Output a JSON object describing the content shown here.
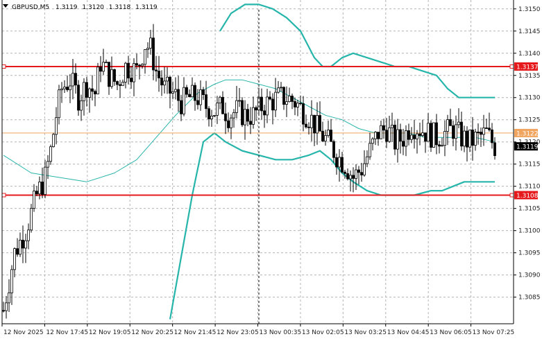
{
  "chart_data": {
    "type": "candlestick",
    "header": {
      "symbol": "GBPUSD,M5",
      "ohlc": [
        "1.3119",
        "1.3120",
        "1.3118",
        "1.3119"
      ]
    },
    "colors": {
      "background": "#ffffff",
      "grid": "#b4b4b4",
      "candle": "#000000",
      "bollinger_outer": "#26b5aa",
      "bollinger_middle": "#26b5aa",
      "hline": "#e5191c",
      "current_price_line": "#f0a45e",
      "axis": "#000000"
    },
    "y_axis": {
      "ylim": [
        1.3079,
        1.3152
      ],
      "ticks": [
        "1.3150",
        "1.3145",
        "1.3140",
        "1.3135",
        "1.3130",
        "1.3125",
        "1.3120",
        "1.3115",
        "1.3110",
        "1.3105",
        "1.3100",
        "1.3095",
        "1.3090",
        "1.3085"
      ]
    },
    "x_axis": {
      "ticks": [
        "12 Nov 2025",
        "12 Nov 17:45",
        "12 Nov 19:05",
        "12 Nov 20:25",
        "12 Nov 21:45",
        "12 Nov 23:05",
        "13 Nov 00:35",
        "13 Nov 02:05",
        "13 Nov 03:25",
        "13 Nov 04:45",
        "13 Nov 06:05",
        "13 Nov 07:25"
      ]
    },
    "horizontal_lines": [
      {
        "price": 1.3137,
        "label": "1.3137",
        "kind": "level"
      },
      {
        "price": 1.3108,
        "label": "1.3108",
        "kind": "level"
      },
      {
        "price": 1.3122,
        "label": "1.3122",
        "kind": "orange"
      }
    ],
    "current_price_label": "1.3119",
    "crosshair_bar": 92,
    "candles_close_path": [
      [
        0,
        1.3082
      ],
      [
        4,
        1.3095
      ],
      [
        8,
        1.31
      ],
      [
        12,
        1.3108
      ],
      [
        15,
        1.3112
      ],
      [
        17,
        1.3118
      ],
      [
        19,
        1.3126
      ],
      [
        21,
        1.3132
      ],
      [
        24,
        1.3134
      ],
      [
        27,
        1.313
      ],
      [
        30,
        1.3133
      ],
      [
        33,
        1.3131
      ],
      [
        35,
        1.3138
      ],
      [
        38,
        1.3135
      ],
      [
        41,
        1.3133
      ],
      [
        44,
        1.3137
      ],
      [
        48,
        1.3136
      ],
      [
        51,
        1.3142
      ],
      [
        53,
        1.3141
      ],
      [
        55,
        1.3136
      ],
      [
        58,
        1.3132
      ],
      [
        61,
        1.3131
      ],
      [
        64,
        1.3129
      ],
      [
        67,
        1.313
      ],
      [
        70,
        1.313
      ],
      [
        73,
        1.3128
      ],
      [
        76,
        1.3127
      ],
      [
        79,
        1.3128
      ],
      [
        81,
        1.3126
      ],
      [
        84,
        1.3127
      ],
      [
        87,
        1.3126
      ],
      [
        90,
        1.3126
      ],
      [
        93,
        1.3128
      ],
      [
        96,
        1.3129
      ],
      [
        99,
        1.313
      ],
      [
        102,
        1.313
      ],
      [
        105,
        1.3129
      ],
      [
        108,
        1.3127
      ],
      [
        111,
        1.3125
      ],
      [
        114,
        1.3122
      ],
      [
        117,
        1.312
      ],
      [
        120,
        1.3117
      ],
      [
        123,
        1.3115
      ],
      [
        126,
        1.3112
      ],
      [
        129,
        1.3114
      ],
      [
        132,
        1.3118
      ],
      [
        135,
        1.3122
      ],
      [
        138,
        1.3123
      ],
      [
        141,
        1.312
      ],
      [
        144,
        1.3121
      ],
      [
        147,
        1.3124
      ],
      [
        150,
        1.3123
      ],
      [
        153,
        1.3122
      ],
      [
        156,
        1.3121
      ],
      [
        159,
        1.3122
      ],
      [
        162,
        1.3123
      ],
      [
        165,
        1.3121
      ],
      [
        168,
        1.312
      ],
      [
        171,
        1.3121
      ],
      [
        174,
        1.3122
      ],
      [
        177,
        1.3119
      ]
    ],
    "bb_upper": [
      [
        78,
        1.3145
      ],
      [
        82,
        1.3149
      ],
      [
        87,
        1.3151
      ],
      [
        92,
        1.3151
      ],
      [
        97,
        1.315
      ],
      [
        102,
        1.3148
      ],
      [
        107,
        1.3145
      ],
      [
        112,
        1.3139
      ],
      [
        115,
        1.3137
      ],
      [
        118,
        1.3137
      ],
      [
        122,
        1.3139
      ],
      [
        126,
        1.314
      ],
      [
        131,
        1.3139
      ],
      [
        136,
        1.3138
      ],
      [
        141,
        1.3137
      ],
      [
        146,
        1.3137
      ],
      [
        151,
        1.3136
      ],
      [
        156,
        1.3135
      ],
      [
        160,
        1.3132
      ],
      [
        164,
        1.313
      ],
      [
        168,
        1.313
      ],
      [
        173,
        1.313
      ],
      [
        177,
        1.313
      ]
    ],
    "bb_middle": [
      [
        0,
        1.3117
      ],
      [
        10,
        1.3113
      ],
      [
        20,
        1.3112
      ],
      [
        30,
        1.3111
      ],
      [
        40,
        1.3113
      ],
      [
        48,
        1.3116
      ],
      [
        55,
        1.3121
      ],
      [
        62,
        1.3126
      ],
      [
        70,
        1.3131
      ],
      [
        76,
        1.3133
      ],
      [
        80,
        1.3134
      ],
      [
        86,
        1.3134
      ],
      [
        92,
        1.3133
      ],
      [
        98,
        1.3132
      ],
      [
        104,
        1.313
      ],
      [
        110,
        1.3128
      ],
      [
        116,
        1.3126
      ],
      [
        122,
        1.3125
      ],
      [
        128,
        1.3123
      ],
      [
        134,
        1.3122
      ],
      [
        140,
        1.3122
      ],
      [
        146,
        1.3122
      ],
      [
        152,
        1.3121
      ],
      [
        158,
        1.3121
      ],
      [
        164,
        1.3121
      ],
      [
        170,
        1.3121
      ],
      [
        177,
        1.312
      ]
    ],
    "bb_lower": [
      [
        60,
        1.308
      ],
      [
        64,
        1.3094
      ],
      [
        68,
        1.3108
      ],
      [
        72,
        1.312
      ],
      [
        76,
        1.3122
      ],
      [
        80,
        1.312
      ],
      [
        86,
        1.3118
      ],
      [
        92,
        1.3117
      ],
      [
        98,
        1.3116
      ],
      [
        104,
        1.3116
      ],
      [
        110,
        1.3117
      ],
      [
        114,
        1.3118
      ],
      [
        118,
        1.3116
      ],
      [
        122,
        1.3113
      ],
      [
        126,
        1.3111
      ],
      [
        131,
        1.3109
      ],
      [
        136,
        1.3108
      ],
      [
        142,
        1.3108
      ],
      [
        148,
        1.3108
      ],
      [
        154,
        1.3109
      ],
      [
        158,
        1.3109
      ],
      [
        162,
        1.311
      ],
      [
        166,
        1.3111
      ],
      [
        172,
        1.3111
      ],
      [
        177,
        1.3111
      ]
    ]
  }
}
